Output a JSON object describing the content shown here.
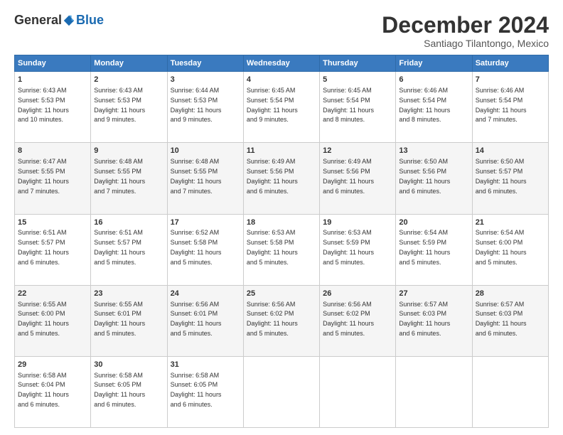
{
  "logo": {
    "general": "General",
    "blue": "Blue"
  },
  "title": "December 2024",
  "subtitle": "Santiago Tilantongo, Mexico",
  "days_header": [
    "Sunday",
    "Monday",
    "Tuesday",
    "Wednesday",
    "Thursday",
    "Friday",
    "Saturday"
  ],
  "weeks": [
    [
      {
        "day": "1",
        "info": "Sunrise: 6:43 AM\nSunset: 5:53 PM\nDaylight: 11 hours\nand 10 minutes."
      },
      {
        "day": "2",
        "info": "Sunrise: 6:43 AM\nSunset: 5:53 PM\nDaylight: 11 hours\nand 9 minutes."
      },
      {
        "day": "3",
        "info": "Sunrise: 6:44 AM\nSunset: 5:53 PM\nDaylight: 11 hours\nand 9 minutes."
      },
      {
        "day": "4",
        "info": "Sunrise: 6:45 AM\nSunset: 5:54 PM\nDaylight: 11 hours\nand 9 minutes."
      },
      {
        "day": "5",
        "info": "Sunrise: 6:45 AM\nSunset: 5:54 PM\nDaylight: 11 hours\nand 8 minutes."
      },
      {
        "day": "6",
        "info": "Sunrise: 6:46 AM\nSunset: 5:54 PM\nDaylight: 11 hours\nand 8 minutes."
      },
      {
        "day": "7",
        "info": "Sunrise: 6:46 AM\nSunset: 5:54 PM\nDaylight: 11 hours\nand 7 minutes."
      }
    ],
    [
      {
        "day": "8",
        "info": "Sunrise: 6:47 AM\nSunset: 5:55 PM\nDaylight: 11 hours\nand 7 minutes."
      },
      {
        "day": "9",
        "info": "Sunrise: 6:48 AM\nSunset: 5:55 PM\nDaylight: 11 hours\nand 7 minutes."
      },
      {
        "day": "10",
        "info": "Sunrise: 6:48 AM\nSunset: 5:55 PM\nDaylight: 11 hours\nand 7 minutes."
      },
      {
        "day": "11",
        "info": "Sunrise: 6:49 AM\nSunset: 5:56 PM\nDaylight: 11 hours\nand 6 minutes."
      },
      {
        "day": "12",
        "info": "Sunrise: 6:49 AM\nSunset: 5:56 PM\nDaylight: 11 hours\nand 6 minutes."
      },
      {
        "day": "13",
        "info": "Sunrise: 6:50 AM\nSunset: 5:56 PM\nDaylight: 11 hours\nand 6 minutes."
      },
      {
        "day": "14",
        "info": "Sunrise: 6:50 AM\nSunset: 5:57 PM\nDaylight: 11 hours\nand 6 minutes."
      }
    ],
    [
      {
        "day": "15",
        "info": "Sunrise: 6:51 AM\nSunset: 5:57 PM\nDaylight: 11 hours\nand 6 minutes."
      },
      {
        "day": "16",
        "info": "Sunrise: 6:51 AM\nSunset: 5:57 PM\nDaylight: 11 hours\nand 5 minutes."
      },
      {
        "day": "17",
        "info": "Sunrise: 6:52 AM\nSunset: 5:58 PM\nDaylight: 11 hours\nand 5 minutes."
      },
      {
        "day": "18",
        "info": "Sunrise: 6:53 AM\nSunset: 5:58 PM\nDaylight: 11 hours\nand 5 minutes."
      },
      {
        "day": "19",
        "info": "Sunrise: 6:53 AM\nSunset: 5:59 PM\nDaylight: 11 hours\nand 5 minutes."
      },
      {
        "day": "20",
        "info": "Sunrise: 6:54 AM\nSunset: 5:59 PM\nDaylight: 11 hours\nand 5 minutes."
      },
      {
        "day": "21",
        "info": "Sunrise: 6:54 AM\nSunset: 6:00 PM\nDaylight: 11 hours\nand 5 minutes."
      }
    ],
    [
      {
        "day": "22",
        "info": "Sunrise: 6:55 AM\nSunset: 6:00 PM\nDaylight: 11 hours\nand 5 minutes."
      },
      {
        "day": "23",
        "info": "Sunrise: 6:55 AM\nSunset: 6:01 PM\nDaylight: 11 hours\nand 5 minutes."
      },
      {
        "day": "24",
        "info": "Sunrise: 6:56 AM\nSunset: 6:01 PM\nDaylight: 11 hours\nand 5 minutes."
      },
      {
        "day": "25",
        "info": "Sunrise: 6:56 AM\nSunset: 6:02 PM\nDaylight: 11 hours\nand 5 minutes."
      },
      {
        "day": "26",
        "info": "Sunrise: 6:56 AM\nSunset: 6:02 PM\nDaylight: 11 hours\nand 5 minutes."
      },
      {
        "day": "27",
        "info": "Sunrise: 6:57 AM\nSunset: 6:03 PM\nDaylight: 11 hours\nand 6 minutes."
      },
      {
        "day": "28",
        "info": "Sunrise: 6:57 AM\nSunset: 6:03 PM\nDaylight: 11 hours\nand 6 minutes."
      }
    ],
    [
      {
        "day": "29",
        "info": "Sunrise: 6:58 AM\nSunset: 6:04 PM\nDaylight: 11 hours\nand 6 minutes."
      },
      {
        "day": "30",
        "info": "Sunrise: 6:58 AM\nSunset: 6:05 PM\nDaylight: 11 hours\nand 6 minutes."
      },
      {
        "day": "31",
        "info": "Sunrise: 6:58 AM\nSunset: 6:05 PM\nDaylight: 11 hours\nand 6 minutes."
      },
      null,
      null,
      null,
      null
    ]
  ]
}
